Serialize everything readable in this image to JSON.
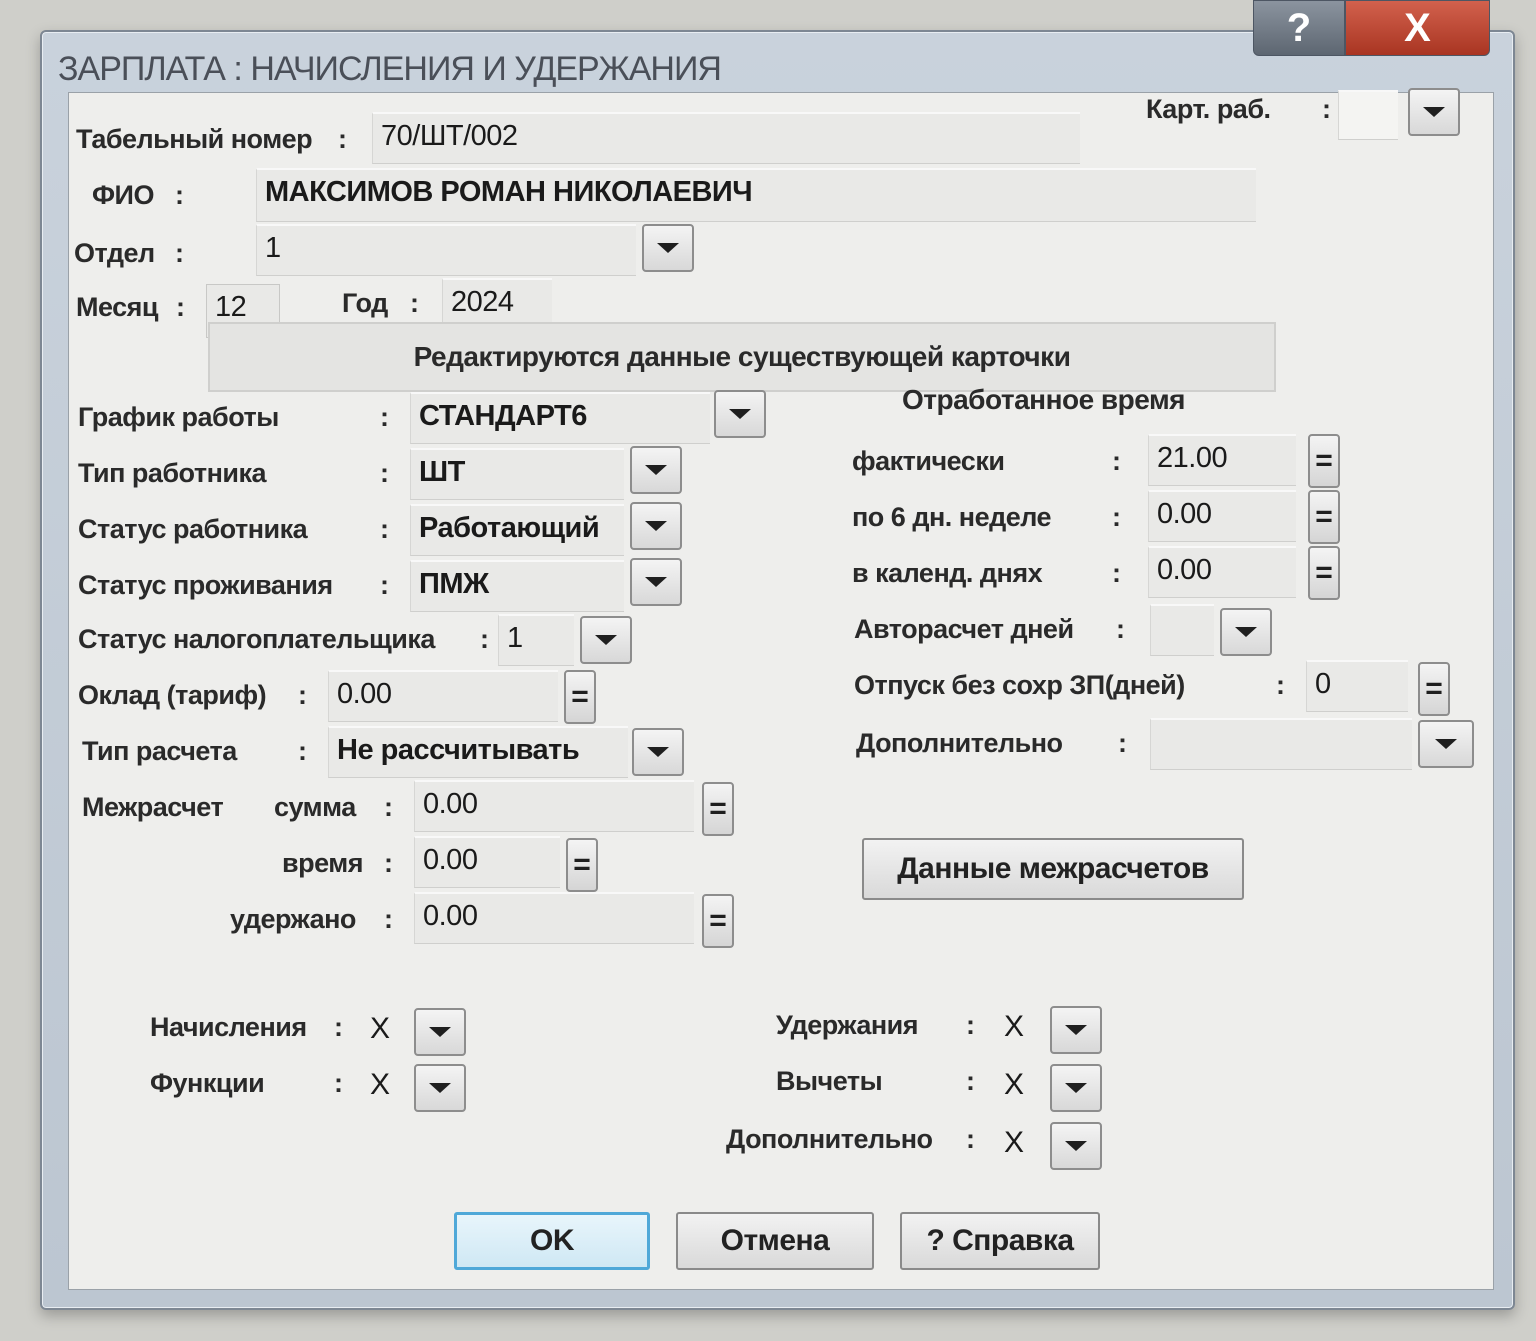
{
  "window": {
    "title": "ЗАРПЛАТА : НАЧИСЛЕНИЯ И УДЕРЖАНИЯ",
    "help_btn": "?",
    "close_btn": "X"
  },
  "header": {
    "tab_number_label": "Табельный номер",
    "tab_number_value": "70/ШТ/002",
    "card_label": "Карт. раб.",
    "card_value": "",
    "fio_label": "ФИО",
    "fio_value": "МАКСИМОВ РОМАН НИКОЛАЕВИЧ",
    "dept_label": "Отдел",
    "dept_value": "1",
    "month_label": "Месяц",
    "month_value": "12",
    "year_label": "Год",
    "year_value": "2024",
    "banner": "Редактируются данные существующей карточки"
  },
  "left": {
    "schedule_label": "График работы",
    "schedule_value": "СТАНДАРТ6",
    "worker_type_label": "Тип работника",
    "worker_type_value": "ШТ",
    "worker_status_label": "Статус работника",
    "worker_status_value": "Работающий",
    "residence_label": "Статус проживания",
    "residence_value": "ПМЖ",
    "taxpayer_label": "Статус налогоплательщика",
    "taxpayer_value": "1",
    "salary_label": "Оклад (тариф)",
    "salary_value": "0.00",
    "calc_type_label": "Тип расчета",
    "calc_type_value": "Не рассчитывать",
    "mezh_label": "Межрасчет",
    "mezh_sum_label": "сумма",
    "mezh_sum_value": "0.00",
    "mezh_time_label": "время",
    "mezh_time_value": "0.00",
    "mezh_withheld_label": "удержано",
    "mezh_withheld_value": "0.00"
  },
  "right": {
    "title": "Отработанное время",
    "actual_label": "фактически",
    "actual_value": "21.00",
    "six_day_label": "по 6 дн. неделе",
    "six_day_value": "0.00",
    "calendar_label": "в календ. днях",
    "calendar_value": "0.00",
    "autocalc_label": "Авторасчет дней",
    "autocalc_value": "",
    "unpaid_leave_label": "Отпуск без сохр ЗП(дней)",
    "unpaid_leave_value": "0",
    "additional_label": "Дополнительно",
    "additional_value": "",
    "mezh_data_button": "Данные межрасчетов"
  },
  "bottom": {
    "accruals_label": "Начисления",
    "accruals_value": "X",
    "functions_label": "Функции",
    "functions_value": "X",
    "withholdings_label": "Удержания",
    "withholdings_value": "X",
    "deductions_label": "Вычеты",
    "deductions_value": "X",
    "additional_label": "Дополнительно",
    "additional_value": "X"
  },
  "buttons": {
    "ok": "OK",
    "cancel": "Отмена",
    "help": "? Справка"
  },
  "common": {
    "colon": ":",
    "calc_glyph": "="
  }
}
